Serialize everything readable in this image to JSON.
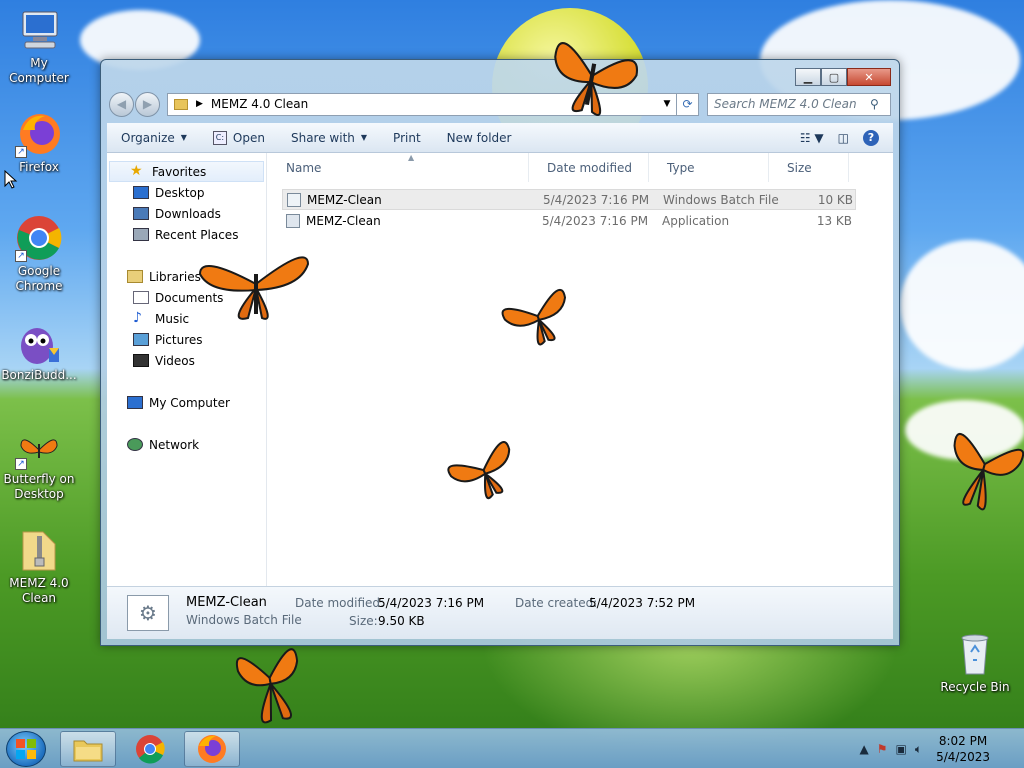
{
  "desktop": {
    "icons": [
      {
        "label": "My Computer"
      },
      {
        "label": "Firefox"
      },
      {
        "label": "Google Chrome"
      },
      {
        "label": "BonziBudd..."
      },
      {
        "label": "Butterfly on Desktop"
      },
      {
        "label": "MEMZ 4.0 Clean"
      },
      {
        "label": "Recycle Bin"
      }
    ]
  },
  "window": {
    "address": "MEMZ 4.0 Clean",
    "search_placeholder": "Search MEMZ 4.0 Clean",
    "toolbar": {
      "organize": "Organize",
      "open": "Open",
      "share_with": "Share with",
      "print": "Print",
      "new_folder": "New folder"
    },
    "nav": {
      "favorites": "Favorites",
      "desktop": "Desktop",
      "downloads": "Downloads",
      "recent": "Recent Places",
      "libraries": "Libraries",
      "documents": "Documents",
      "music": "Music",
      "pictures": "Pictures",
      "videos": "Videos",
      "computer": "My Computer",
      "network": "Network"
    },
    "columns": {
      "name": "Name",
      "date": "Date modified",
      "type": "Type",
      "size": "Size"
    },
    "files": [
      {
        "name": "MEMZ-Clean",
        "date": "5/4/2023 7:16 PM",
        "type": "Windows Batch File",
        "size": "10 KB"
      },
      {
        "name": "MEMZ-Clean",
        "date": "5/4/2023 7:16 PM",
        "type": "Application",
        "size": "13 KB"
      }
    ],
    "details": {
      "name": "MEMZ-Clean",
      "type": "Windows Batch File",
      "date_modified_label": "Date modified:",
      "date_modified": "5/4/2023 7:16 PM",
      "size_label": "Size:",
      "size": "9.50 KB",
      "date_created_label": "Date created:",
      "date_created": "5/4/2023 7:52 PM"
    }
  },
  "taskbar": {
    "time": "8:02 PM",
    "date": "5/4/2023"
  },
  "colors": {
    "accent": "#1e395b",
    "butterfly": "#f07a12"
  }
}
